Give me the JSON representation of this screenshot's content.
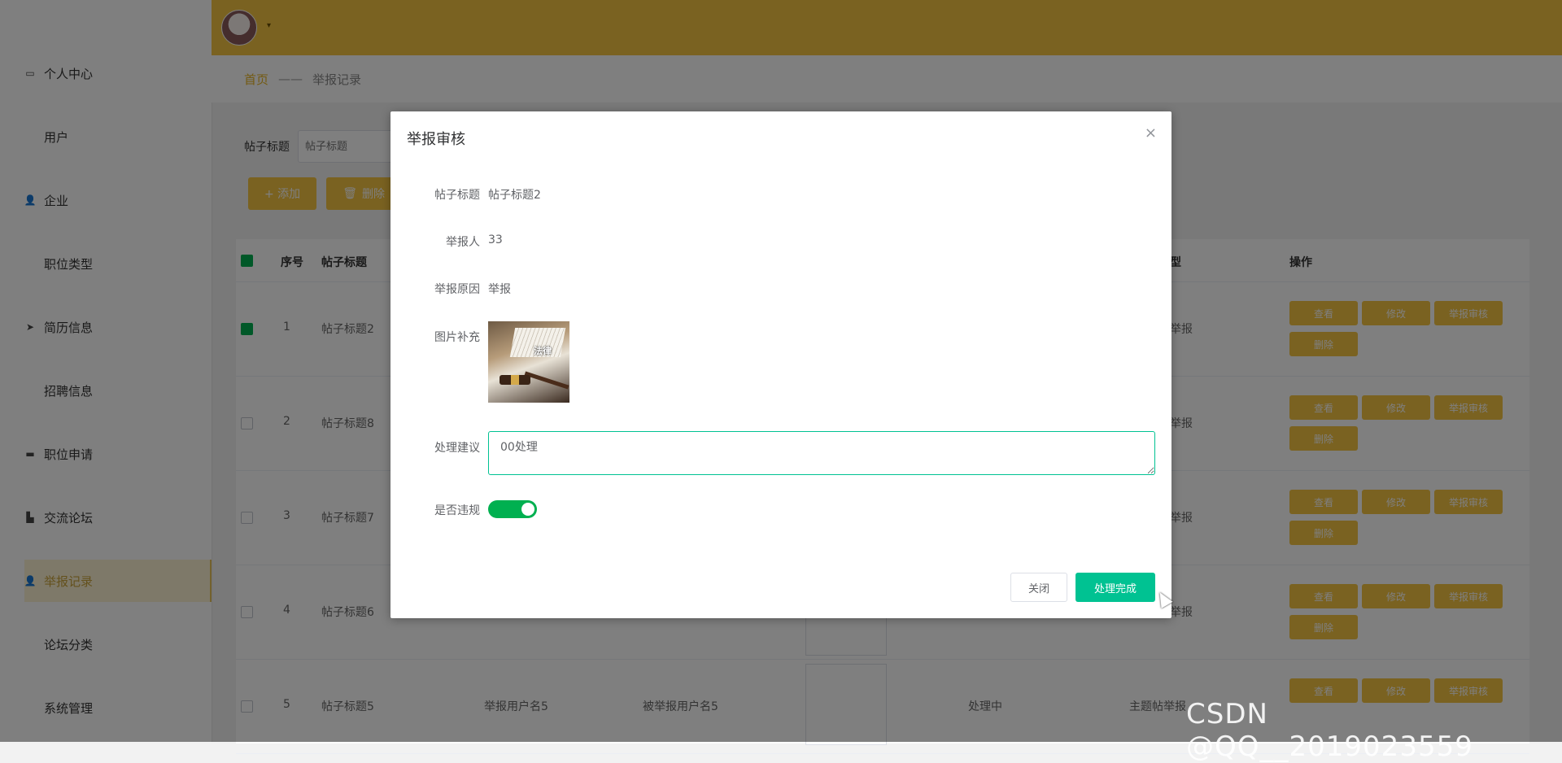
{
  "sidebar": {
    "items": [
      {
        "label": "个人中心",
        "icon": "user-profile-icon"
      },
      {
        "label": "用户",
        "icon": "grid-icon"
      },
      {
        "label": "企业",
        "icon": "person-icon"
      },
      {
        "label": "职位类型",
        "icon": "grid-icon"
      },
      {
        "label": "简历信息",
        "icon": "paper-plane-icon"
      },
      {
        "label": "招聘信息",
        "icon": "grid-icon"
      },
      {
        "label": "职位申请",
        "icon": "briefcase-icon"
      },
      {
        "label": "交流论坛",
        "icon": "forum-icon"
      },
      {
        "label": "举报记录",
        "icon": "person-icon",
        "active": true
      },
      {
        "label": "论坛分类",
        "icon": "grid-icon"
      },
      {
        "label": "系统管理",
        "icon": "grid-icon"
      }
    ]
  },
  "breadcrumb": {
    "home": "首页",
    "separator": "——",
    "current": "举报记录"
  },
  "search": {
    "label": "帖子标题",
    "placeholder": "帖子标题"
  },
  "toolbar": {
    "add_label": "+ 添加",
    "delete_label": "删除"
  },
  "table": {
    "headers": {
      "index": "序号",
      "title": "帖子标题",
      "col_status": "型",
      "actions": "操作"
    },
    "rows": [
      {
        "index": "1",
        "title": "帖子标题2",
        "status": "举报",
        "checked": true
      },
      {
        "index": "2",
        "title": "帖子标题8",
        "status": "举报",
        "checked": false
      },
      {
        "index": "3",
        "title": "帖子标题7",
        "status": "举报",
        "checked": false
      },
      {
        "index": "4",
        "title": "帖子标题6",
        "status": "举报",
        "checked": false
      },
      {
        "index": "5",
        "title": "帖子标题5",
        "reporter": "举报用户名5",
        "reported": "被举报用户名5",
        "process": "处理中",
        "status": "主题帖举报",
        "checked": false
      }
    ],
    "op_labels": {
      "view": "查看",
      "edit": "修改",
      "review": "举报审核",
      "delete": "删除"
    }
  },
  "dialog": {
    "title": "举报审核",
    "close_icon": "×",
    "fields": {
      "title_label": "帖子标题",
      "title_value": "帖子标题2",
      "reporter_label": "举报人",
      "reporter_value": "33",
      "reason_label": "举报原因",
      "reason_value": "举报",
      "image_label": "图片补充",
      "image_text": "法律",
      "suggest_label": "处理建议",
      "suggest_value": "00处理",
      "violation_label": "是否违规"
    },
    "violation_on": true,
    "buttons": {
      "close": "关闭",
      "done": "处理完成"
    }
  },
  "watermark": "CSDN @QQ__2019023559",
  "colors": {
    "header": "#f5c542",
    "accent_green": "#00c292",
    "switch_on": "#00b050"
  }
}
